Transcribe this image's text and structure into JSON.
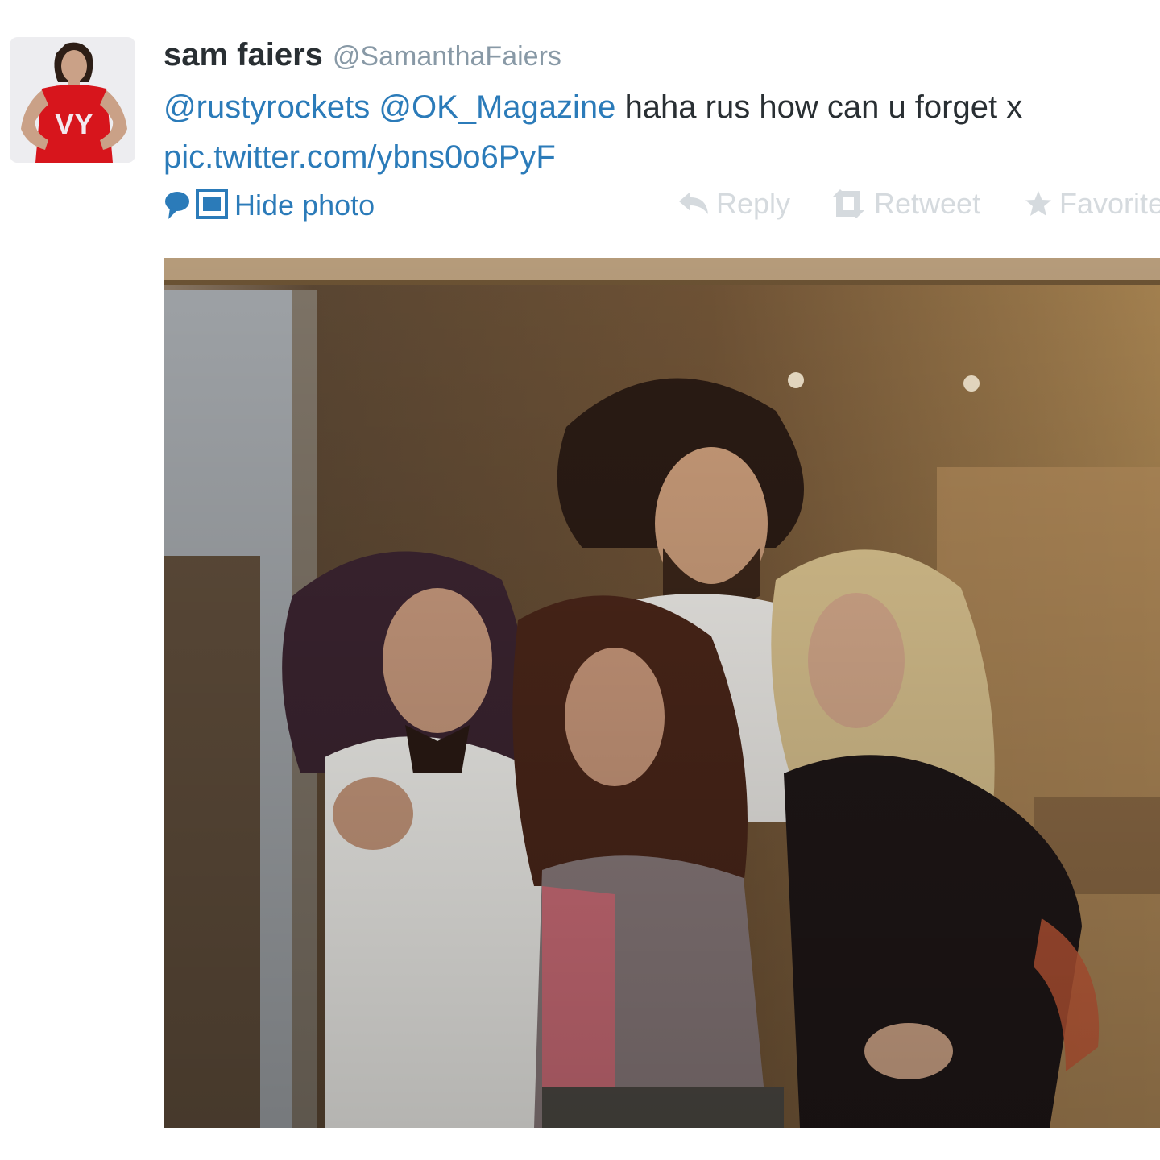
{
  "tweet": {
    "author_name": "sam faiers",
    "author_handle": "@SamanthaFaiers",
    "text": {
      "mention_1": "@rustyrockets",
      "mention_2": "@OK_Magazine",
      "body": "haha rus how can u forget x",
      "pic_link": "pic.twitter.com/ybns0o6PyF"
    },
    "avatar_icon": "profile-avatar",
    "avatar_shirt_text": "VY",
    "actions": {
      "hide_photo_label": "Hide photo",
      "reply_label": "Reply",
      "retweet_label": "Retweet",
      "favorite_label": "Favorite"
    },
    "photo_icon": "embedded-photo"
  },
  "colors": {
    "link": "#2b7bb9",
    "text": "#292f33",
    "muted": "#8899a6",
    "action_disabled": "#d5dade"
  }
}
